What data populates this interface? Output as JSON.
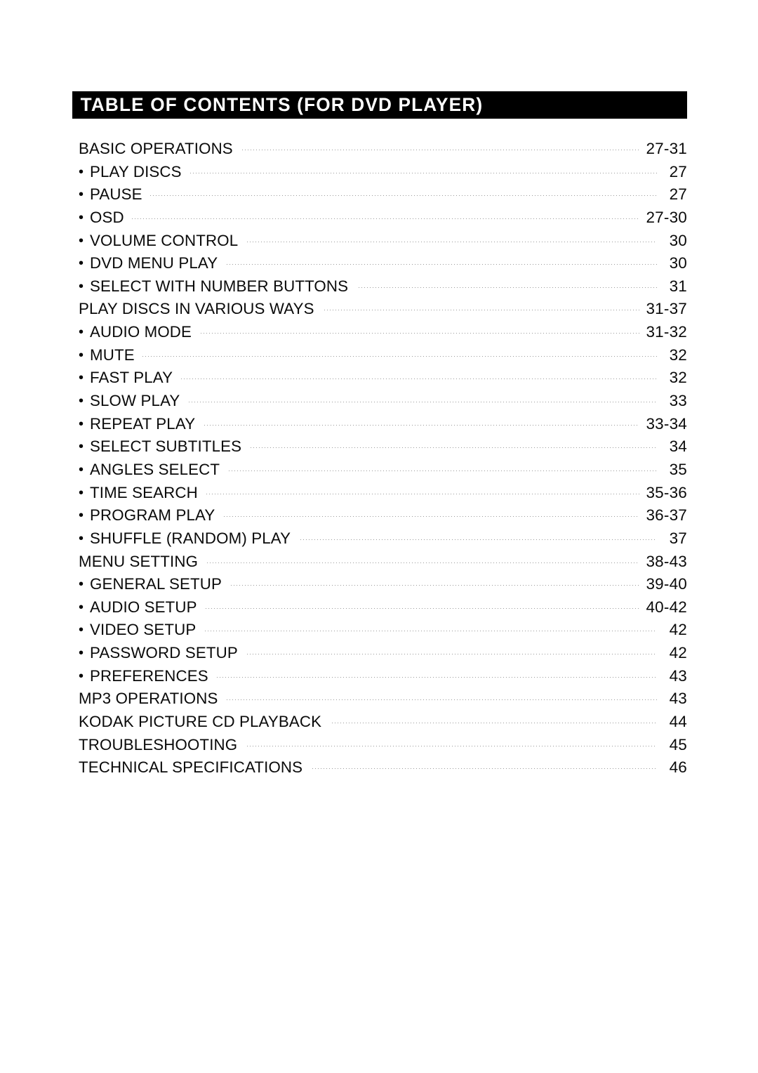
{
  "document": {
    "header": {
      "title": "TABLE OF CONTENTS (FOR DVD PLAYER)",
      "background_color": "#000000",
      "text_color": "#ffffff"
    },
    "leader_style": "dotted",
    "leader_color": "#9a9a9a",
    "bullet_glyph": "•",
    "entries": [
      {
        "label": "BASIC OPERATIONS",
        "page": "27-31",
        "level": 0
      },
      {
        "label": "PLAY DISCS",
        "page": "27",
        "level": 1
      },
      {
        "label": "PAUSE",
        "page": "27",
        "level": 1
      },
      {
        "label": "OSD",
        "page": "27-30",
        "level": 1
      },
      {
        "label": "VOLUME CONTROL",
        "page": "30",
        "level": 1
      },
      {
        "label": "DVD MENU PLAY",
        "page": "30",
        "level": 1
      },
      {
        "label": "SELECT WITH NUMBER BUTTONS",
        "page": "31",
        "level": 1
      },
      {
        "label": "PLAY DISCS IN VARIOUS WAYS",
        "page": "31-37",
        "level": 0
      },
      {
        "label": "AUDIO MODE",
        "page": "31-32",
        "level": 1
      },
      {
        "label": "MUTE",
        "page": "32",
        "level": 1
      },
      {
        "label": "FAST PLAY",
        "page": "32",
        "level": 1
      },
      {
        "label": "SLOW PLAY",
        "page": "33",
        "level": 1
      },
      {
        "label": "REPEAT PLAY",
        "page": "33-34",
        "level": 1
      },
      {
        "label": "SELECT SUBTITLES",
        "page": "34",
        "level": 1
      },
      {
        "label": "ANGLES SELECT",
        "page": "35",
        "level": 1
      },
      {
        "label": "TIME SEARCH",
        "page": "35-36",
        "level": 1
      },
      {
        "label": "PROGRAM PLAY",
        "page": "36-37",
        "level": 1
      },
      {
        "label": "SHUFFLE (RANDOM) PLAY",
        "page": "37",
        "level": 1
      },
      {
        "label": "MENU SETTING",
        "page": "38-43",
        "level": 0
      },
      {
        "label": "GENERAL SETUP",
        "page": "39-40",
        "level": 1
      },
      {
        "label": "AUDIO SETUP",
        "page": "40-42",
        "level": 1
      },
      {
        "label": "VIDEO SETUP",
        "page": "42",
        "level": 1
      },
      {
        "label": "PASSWORD SETUP",
        "page": "42",
        "level": 1
      },
      {
        "label": "PREFERENCES",
        "page": "43",
        "level": 1
      },
      {
        "label": "MP3 OPERATIONS",
        "page": "43",
        "level": 0
      },
      {
        "label": "KODAK PICTURE CD PLAYBACK",
        "page": "44",
        "level": 0
      },
      {
        "label": "TROUBLESHOOTING",
        "page": "45",
        "level": 0
      },
      {
        "label": "TECHNICAL SPECIFICATIONS",
        "page": "46",
        "level": 0
      }
    ]
  }
}
